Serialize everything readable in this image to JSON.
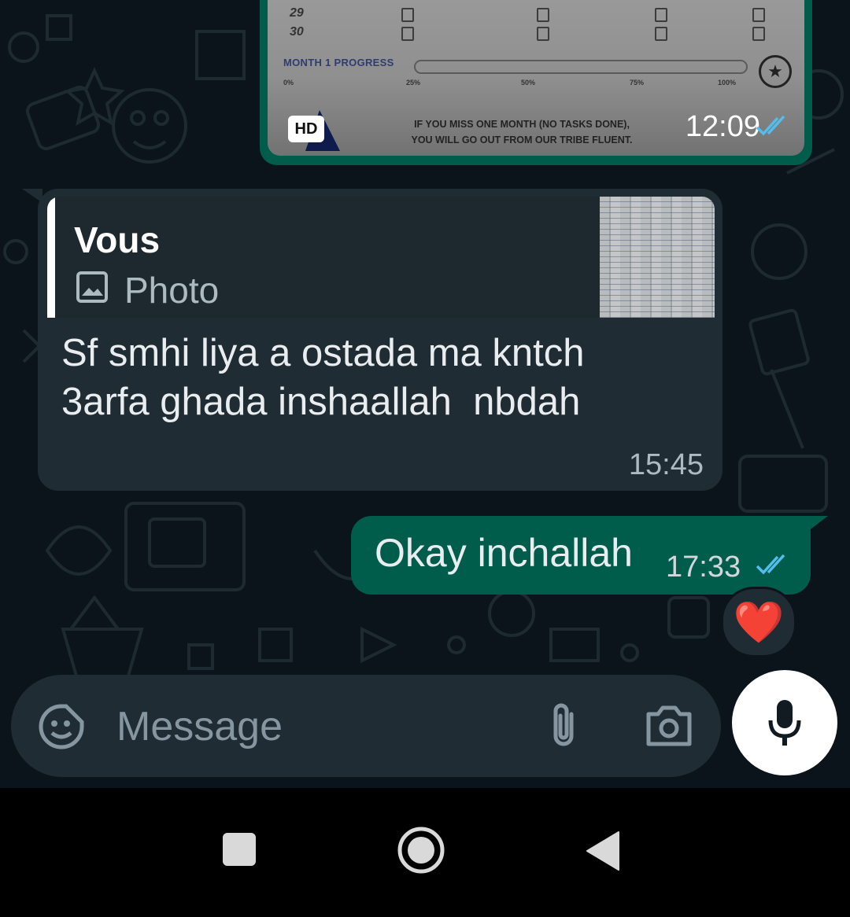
{
  "image_message": {
    "sheet_rows": [
      "29",
      "30"
    ],
    "progress_label": "MONTH 1 PROGRESS",
    "progress_ticks": [
      "0%",
      "25%",
      "50%",
      "75%",
      "100%"
    ],
    "notice_line1": "IF YOU MISS ONE MONTH (NO TASKS DONE),",
    "notice_line2": "YOU WILL GO OUT FROM OUR TRIBE FLUENT.",
    "hd_badge": "HD",
    "time": "12:09",
    "status": "read"
  },
  "incoming_message": {
    "quote_author": "Vous",
    "quote_type": "Photo",
    "quote_icon": "image-icon",
    "text": "Sf smhi liya a ostada ma kntch\n3arfa ghada inshaallah  nbdah",
    "time": "15:45"
  },
  "outgoing_message": {
    "text": "Okay inchallah",
    "time": "17:33",
    "status": "read",
    "reaction": "❤️"
  },
  "composer": {
    "placeholder": "Message",
    "emoji_icon": "sticker-icon",
    "attach_icon": "paperclip-icon",
    "camera_icon": "camera-icon",
    "mic_icon": "microphone-icon"
  },
  "nav": {
    "recents_icon": "square-icon",
    "home_icon": "circle-icon",
    "back_icon": "triangle-back-icon"
  },
  "colors": {
    "background": "#0b141a",
    "incoming_bubble": "#202c33",
    "outgoing_bubble": "#005c4b",
    "read_ticks": "#53bdeb",
    "reaction_heart": "#f3152a"
  }
}
